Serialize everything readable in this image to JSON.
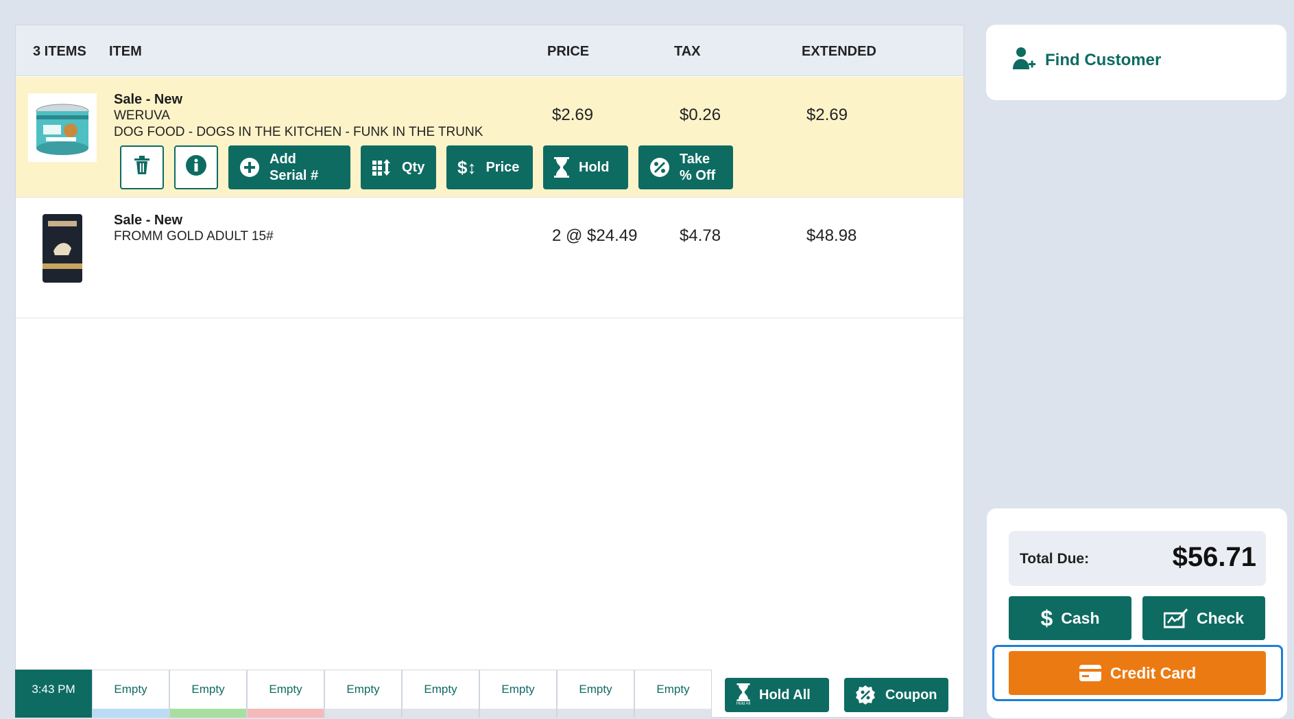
{
  "cart": {
    "header": {
      "count": "3 ITEMS",
      "item": "ITEM",
      "price": "PRICE",
      "tax": "TAX",
      "extended": "EXTENDED"
    },
    "items": [
      {
        "status": "Sale - New",
        "brand": "WERUVA",
        "description": "DOG FOOD - DOGS IN THE KITCHEN - FUNK IN THE TRUNK",
        "price": "$2.69",
        "tax": "$0.26",
        "extended": "$2.69",
        "selected": true
      },
      {
        "status": "Sale - New",
        "brand": "FROMM GOLD ADULT 15#",
        "description": "",
        "price": "2 @ $24.49",
        "tax": "$4.78",
        "extended": "$48.98",
        "selected": false
      }
    ],
    "actions": {
      "add_serial_1": "Add",
      "add_serial_2": "Serial #",
      "qty": "Qty",
      "price": "Price",
      "hold": "Hold",
      "take_off_1": "Take",
      "take_off_2": "% Off"
    }
  },
  "tabs": {
    "time": "3:43 PM",
    "slots": [
      "Empty",
      "Empty",
      "Empty",
      "Empty",
      "Empty",
      "Empty",
      "Empty",
      "Empty"
    ],
    "slot_colors": [
      "#bcdcf5",
      "#a8dfa0",
      "#f6b9b9",
      "#dfe3ea",
      "#dfe3ea",
      "#dfe3ea",
      "#dfe3ea",
      "#dfe3ea"
    ],
    "hold_all": "Hold All",
    "hold_all_icon_caption": "Hold All",
    "coupon": "Coupon"
  },
  "customer": {
    "find_label": "Find Customer"
  },
  "payment": {
    "total_label": "Total Due:",
    "total_amount": "$56.71",
    "cash": "Cash",
    "check": "Check",
    "credit_card": "Credit Card"
  },
  "colors": {
    "primary": "#0e6b62",
    "selected_row": "#fdf3c9",
    "credit_card": "#ec7a12",
    "focus_ring": "#1d7ed6"
  }
}
